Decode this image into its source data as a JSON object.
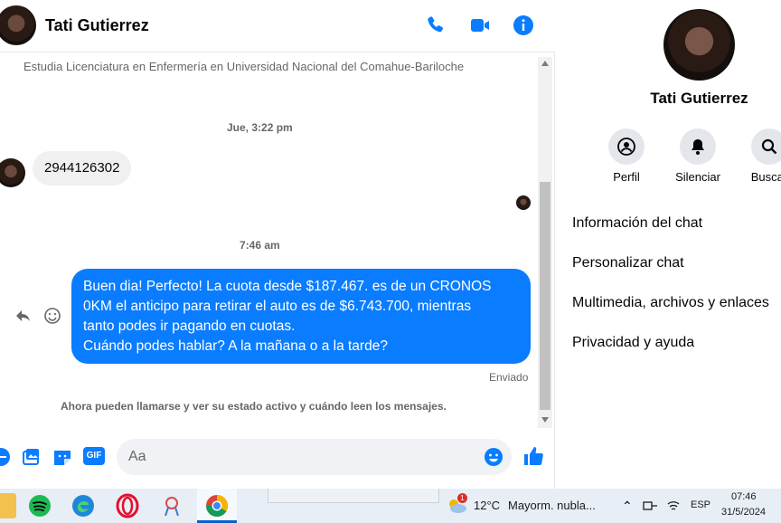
{
  "header": {
    "contact_name": "Tati Gutierrez",
    "icons": [
      "phone-icon",
      "video-icon",
      "info-icon"
    ]
  },
  "conversation": {
    "profile_info": "Estudia Licenciatura en Enfermería en Universidad Nacional del Comahue-Bariloche",
    "timestamp_1": "Jue, 3:22 pm",
    "incoming_message": "2944126302",
    "timestamp_2": "7:46 am",
    "outgoing_message": {
      "line1": "Buen dia! Perfecto! La cuota desde $187.467. es de un CRONOS",
      "line2": "0KM el anticipo para retirar el auto es de $6.743.700, mientras",
      "line3": "tanto podes ir pagando en cuotas.",
      "line4": "Cuándo podes hablar? A la mañana o a la tarde?"
    },
    "status": "Enviado",
    "notice": "Ahora pueden llamarse y ver su estado activo y cuándo leen los mensajes."
  },
  "composer": {
    "placeholder": "Aa",
    "gif_label": "GIF"
  },
  "panel": {
    "name": "Tati Gutierrez",
    "actions": [
      {
        "label": "Perfil",
        "icon": "profile-icon"
      },
      {
        "label": "Silenciar",
        "icon": "bell-icon"
      },
      {
        "label": "Buscar",
        "icon": "search-icon"
      }
    ],
    "menu": [
      "Información del chat",
      "Personalizar chat",
      "Multimedia, archivos y enlaces",
      "Privacidad y ayuda"
    ]
  },
  "taskbar": {
    "weather_temp": "12°C",
    "weather_text": "Mayorm. nubla...",
    "weather_badge": "1",
    "language": "ESP",
    "time": "07:46",
    "date": "31/5/2024"
  },
  "colors": {
    "accent": "#0a7cff",
    "incoming_bubble": "#f0f0f0",
    "taskbar": "#e8eef6"
  }
}
